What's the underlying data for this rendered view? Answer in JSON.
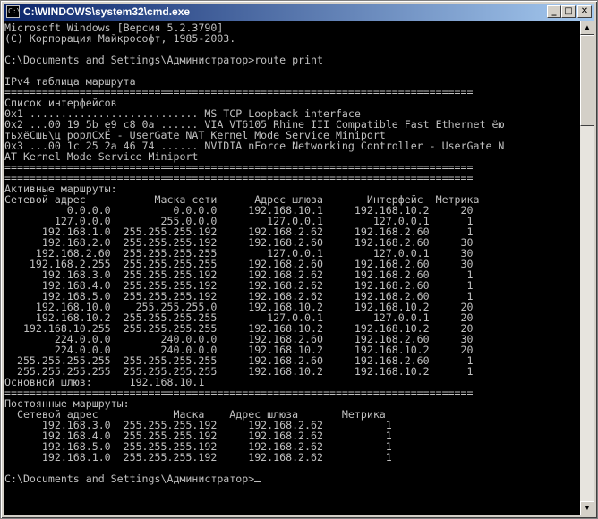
{
  "window": {
    "title": "C:\\WINDOWS\\system32\\cmd.exe",
    "icon_label": "C:\\",
    "controls": {
      "minimize": "_",
      "maximize": "□",
      "close": "✕"
    }
  },
  "console": {
    "lines": [
      "Microsoft Windows [Версия 5.2.3790]",
      "(С) Корпорация Майкрософт, 1985-2003.",
      "",
      "C:\\Documents and Settings\\Администратор>route print",
      "",
      "IPv4 таблица маршрута",
      "===========================================================================",
      "Список интерфейсов",
      "0x1 ........................... MS TCP Loopback interface",
      "0x2 ...00 19 5b e9 c8 0a ...... VIA VT6105 Rhine III Compatible Fast Ethernet ёю",
      "тьхёСшь\\ц рорлСхЁ - UserGate NAT Kernel Mode Service Miniport",
      "0x3 ...00 1c 25 2a 46 74 ...... NVIDIA nForce Networking Controller - UserGate N",
      "AT Kernel Mode Service Miniport",
      "===========================================================================",
      "===========================================================================",
      "Активные маршруты:",
      "Сетевой адрес           Маска сети      Адрес шлюза       Интерфейс  Метрика",
      "          0.0.0.0          0.0.0.0     192.168.10.1     192.168.10.2     20",
      "        127.0.0.0        255.0.0.0        127.0.0.1        127.0.0.1      1",
      "      192.168.1.0  255.255.255.192     192.168.2.62     192.168.2.60      1",
      "      192.168.2.0  255.255.255.192     192.168.2.60     192.168.2.60     30",
      "     192.168.2.60  255.255.255.255        127.0.0.1        127.0.0.1     30",
      "    192.168.2.255  255.255.255.255     192.168.2.60     192.168.2.60     30",
      "      192.168.3.0  255.255.255.192     192.168.2.62     192.168.2.60      1",
      "      192.168.4.0  255.255.255.192     192.168.2.62     192.168.2.60      1",
      "      192.168.5.0  255.255.255.192     192.168.2.62     192.168.2.60      1",
      "     192.168.10.0    255.255.255.0     192.168.10.2     192.168.10.2     20",
      "     192.168.10.2  255.255.255.255        127.0.0.1        127.0.0.1     20",
      "   192.168.10.255  255.255.255.255     192.168.10.2     192.168.10.2     20",
      "        224.0.0.0        240.0.0.0     192.168.2.60     192.168.2.60     30",
      "        224.0.0.0        240.0.0.0     192.168.10.2     192.168.10.2     20",
      "  255.255.255.255  255.255.255.255     192.168.2.60     192.168.2.60      1",
      "  255.255.255.255  255.255.255.255     192.168.10.2     192.168.10.2      1",
      "Основной шлюз:      192.168.10.1",
      "===========================================================================",
      "Постоянные маршруты:",
      "  Сетевой адрес            Маска    Адрес шлюза       Метрика",
      "      192.168.3.0  255.255.255.192     192.168.2.62          1",
      "      192.168.4.0  255.255.255.192     192.168.2.62          1",
      "      192.168.5.0  255.255.255.192     192.168.2.62          1",
      "      192.168.1.0  255.255.255.192     192.168.2.62          1",
      "",
      "C:\\Documents and Settings\\Администратор>"
    ]
  },
  "scrollbar": {
    "up_arrow": "▲",
    "down_arrow": "▼",
    "position_fraction": 0.0
  }
}
